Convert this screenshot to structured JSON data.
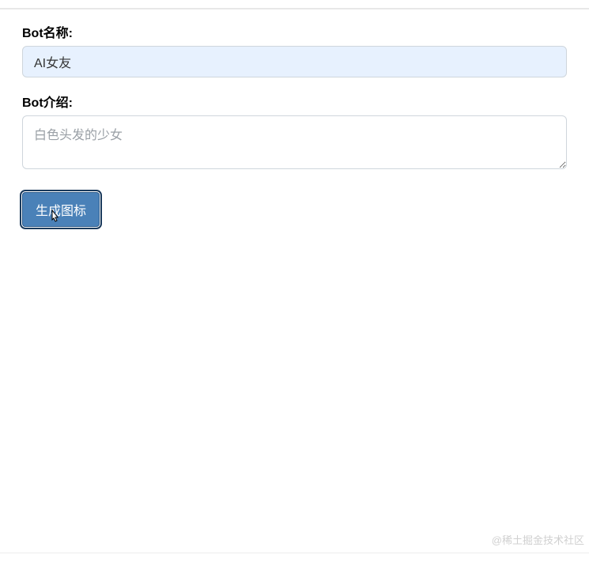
{
  "form": {
    "bot_name": {
      "label": "Bot名称:",
      "value": "AI女友"
    },
    "bot_intro": {
      "label": "Bot介绍:",
      "placeholder": "白色头发的少女",
      "value": ""
    },
    "generate_button_label": "生成图标"
  },
  "watermark": "@稀土掘金技术社区"
}
